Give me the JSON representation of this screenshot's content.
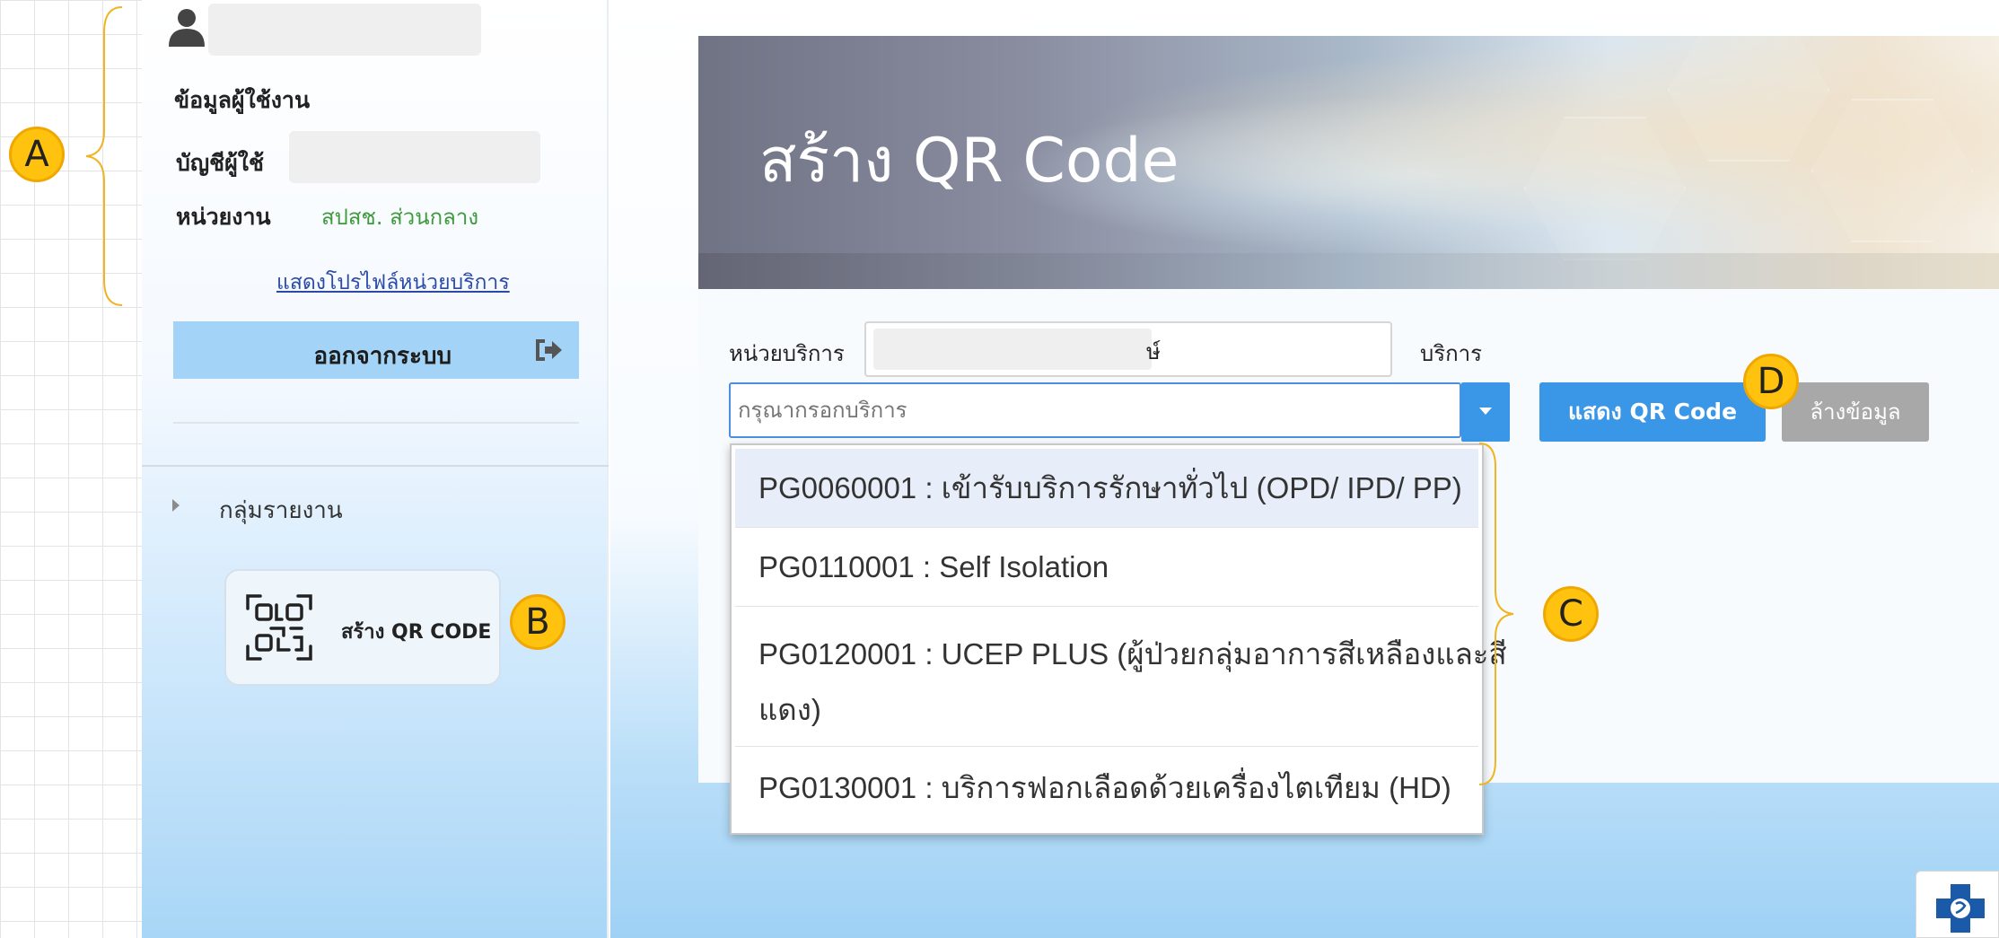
{
  "sidebar": {
    "user_info_title": "ข้อมูลผู้ใช้งาน",
    "account_label": "บัญชีผู้ใช้",
    "unit_label": "หน่วยงาน",
    "unit_value": "สปสช. ส่วนกลาง",
    "profile_link": "แสดงโปรไฟล์หน่วยบริการ",
    "logout_label": "ออกจากระบบ",
    "report_group_label": "กลุ่มรายงาน",
    "qr_menu_label": "สร้าง QR CODE"
  },
  "banner": {
    "title": "สร้าง QR Code"
  },
  "form": {
    "unit_service_label": "หน่วยบริการ",
    "unit_service_visible_char": "ษ์",
    "service_label": "บริการ",
    "service_placeholder": "กรุณากรอกบริการ",
    "show_qr_button": "แสดง QR Code",
    "clear_button": "ล้างข้อมูล"
  },
  "dropdown": {
    "options": [
      {
        "line1": "PG0060001 : เข้ารับบริการรักษาทั่วไป (OPD/ IPD/ PP)",
        "line2": ""
      },
      {
        "line1": "PG0110001 : Self Isolation",
        "line2": ""
      },
      {
        "line1": "PG0120001 : UCEP PLUS (ผู้ป่วยกลุ่มอาการสีเหลืองและสี",
        "line2": "แดง)"
      },
      {
        "line1": "PG0130001 : บริการฟอกเลือดด้วยเครื่องไตเทียม (HD)",
        "line2": ""
      }
    ]
  },
  "annotations": {
    "a": "A",
    "b": "B",
    "c": "C",
    "d": "D"
  },
  "colors": {
    "accent_blue": "#3a97e8",
    "logout_bg": "#a3d4f7",
    "unit_green": "#3f9a3c",
    "badge_yellow": "#ffc20f",
    "link_blue": "#2b4aa8"
  },
  "icons": {
    "user": "user-icon",
    "logout": "logout-icon",
    "report_arrow": "caret-right-icon",
    "qr": "qr-code-icon",
    "dropdown": "caret-down-icon",
    "corner_logo": "nhso-logo-icon"
  }
}
